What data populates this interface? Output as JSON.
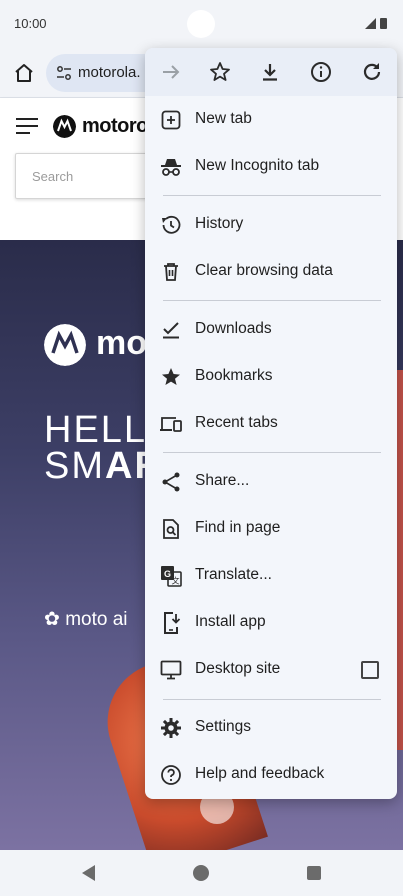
{
  "status": {
    "time": "10:00"
  },
  "toolbar": {
    "url": "motorola."
  },
  "page": {
    "logo_text": "motoro",
    "search_placeholder": "Search",
    "hero_logo_text": "mo",
    "hero_line1": "HELL",
    "hero_line2_a": "SM",
    "hero_line2_b": "AR",
    "moto_ai": "moto ai"
  },
  "menu": {
    "top_icons": [
      "forward-icon",
      "bookmark-star-icon",
      "download-icon",
      "info-icon",
      "refresh-icon"
    ],
    "items": [
      {
        "label": "New tab",
        "icon": "new-tab-icon"
      },
      {
        "label": "New Incognito tab",
        "icon": "incognito-icon"
      },
      {
        "label": "History",
        "icon": "history-icon"
      },
      {
        "label": "Clear browsing data",
        "icon": "trash-icon"
      },
      {
        "label": "Downloads",
        "icon": "downloads-check-icon"
      },
      {
        "label": "Bookmarks",
        "icon": "star-icon"
      },
      {
        "label": "Recent tabs",
        "icon": "devices-icon"
      },
      {
        "label": "Share...",
        "icon": "share-icon"
      },
      {
        "label": "Find in page",
        "icon": "find-in-page-icon"
      },
      {
        "label": "Translate...",
        "icon": "translate-icon"
      },
      {
        "label": "Install app",
        "icon": "install-app-icon"
      },
      {
        "label": "Desktop site",
        "icon": "desktop-icon",
        "checked": false
      },
      {
        "label": "Settings",
        "icon": "settings-gear-icon"
      },
      {
        "label": "Help and feedback",
        "icon": "help-icon"
      }
    ]
  },
  "colors": {
    "menu_bg": "#f3f6fb",
    "menu_top_bg": "#e9eef7",
    "icon": "#2b2b2b"
  }
}
